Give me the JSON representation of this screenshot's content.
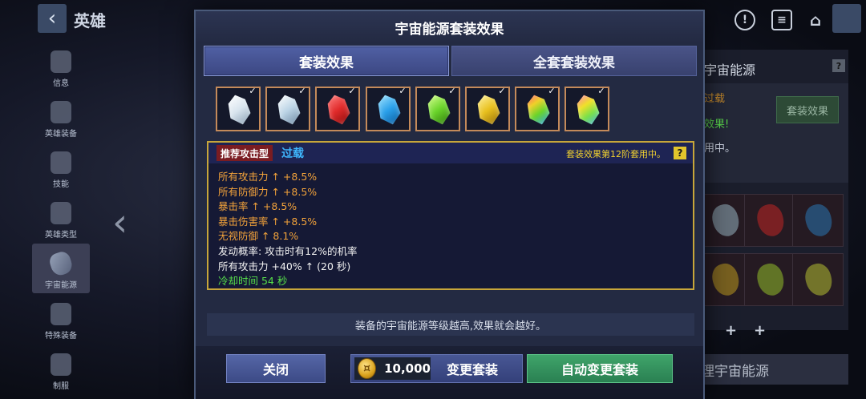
{
  "background": {
    "page_title": "英雄",
    "rail": [
      {
        "label": "信息",
        "icon": "helmet-icon"
      },
      {
        "label": "英雄装备",
        "icon": "hammer-icon"
      },
      {
        "label": "技能",
        "icon": "fist-icon"
      },
      {
        "label": "英雄类型",
        "icon": "spinner-icon"
      },
      {
        "label": "宇宙能源",
        "icon": "gem-icon",
        "active": true
      },
      {
        "label": "特殊装备",
        "icon": "figure-icon"
      },
      {
        "label": "制服",
        "icon": "mask-icon"
      }
    ],
    "right_panel": {
      "title": "宇宙能源",
      "line1": "过载",
      "line2": "效果!",
      "line3": "用中。",
      "button": "套装效果",
      "bottom_label": "理宇宙能源"
    }
  },
  "modal": {
    "title": "宇宙能源套装效果",
    "tabs": {
      "active": "套装效果",
      "inactive": "全套套装效果"
    },
    "gems": [
      {
        "name": "white-gem",
        "color": "#d8e4ee",
        "checked": true
      },
      {
        "name": "silver-gem",
        "color": "#bcd4e6",
        "checked": true
      },
      {
        "name": "red-gem",
        "color": "#e02a2a",
        "checked": true
      },
      {
        "name": "blue-gem",
        "color": "#2aa0ea",
        "checked": true
      },
      {
        "name": "green-gem",
        "color": "#6ad42a",
        "checked": true
      },
      {
        "name": "yellow-gem",
        "color": "#e8c01e",
        "checked": true
      },
      {
        "name": "rainbow-gem",
        "color": "#b8e02a",
        "checked": true
      },
      {
        "name": "rainbow-gem-2",
        "color": "#e6d43a",
        "checked": true
      }
    ],
    "detail": {
      "tag": "推荐攻击型",
      "set_name": "过载",
      "applied": "套装效果第12阶套用中。",
      "help": "?",
      "lines": [
        {
          "text": "所有攻击力 ↑ +8.5%",
          "color": "orange"
        },
        {
          "text": "所有防御力 ↑ +8.5%",
          "color": "orange"
        },
        {
          "text": "暴击率 ↑ +8.5%",
          "color": "orange"
        },
        {
          "text": "暴击伤害率 ↑ +8.5%",
          "color": "orange"
        },
        {
          "text": "无视防御 ↑ 8.1%",
          "color": "orange"
        },
        {
          "text": "发动概率: 攻击时有12%的机率",
          "color": "white"
        },
        {
          "text": "所有攻击力 +40% ↑ (20 秒)",
          "color": "white"
        },
        {
          "text": "冷却时间 54 秒",
          "color": "green"
        }
      ]
    },
    "footnote": "装备的宇宙能源等级越高,效果就会越好。",
    "buttons": {
      "close": "关闭",
      "cost": "10,000",
      "change": "变更套装",
      "auto_change": "自动变更套装"
    }
  }
}
